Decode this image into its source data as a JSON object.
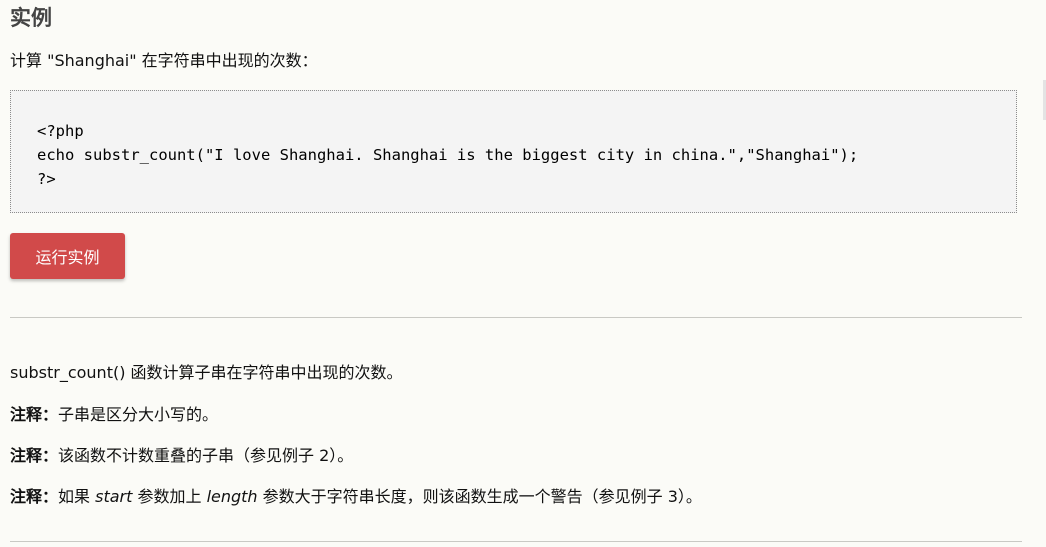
{
  "section": {
    "title": "实例",
    "intro": "计算 \"Shanghai\" 在字符串中出现的次数："
  },
  "code": {
    "line1": "<?php",
    "line2": "echo substr_count(\"I love Shanghai. Shanghai is the biggest city in china.\",\"Shanghai\");",
    "line3": "?>"
  },
  "run_button": {
    "label": "运行实例",
    "color": "#d14a4a"
  },
  "description": {
    "p1": "substr_count() 函数计算子串在字符串中出现的次数。",
    "note_label": "注释：",
    "p2_text": "子串是区分大小写的。",
    "p3_text": "该函数不计数重叠的子串（参见例子 2）。",
    "p4_a": "如果 ",
    "p4_start": "start",
    "p4_b": " 参数加上 ",
    "p4_length": "length",
    "p4_c": " 参数大于字符串长度，则该函数生成一个警告（参见例子 3）。"
  }
}
